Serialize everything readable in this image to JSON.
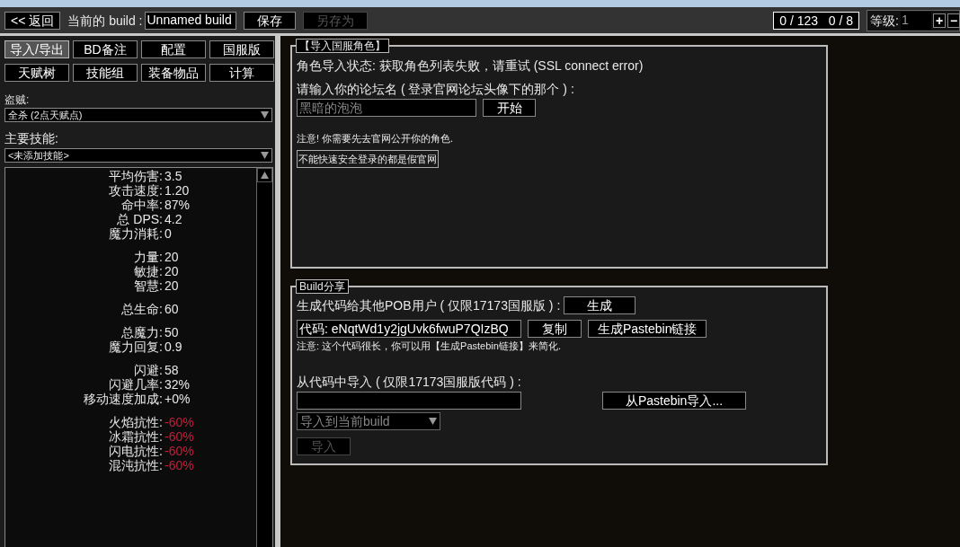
{
  "toolbar": {
    "back_button": "<< 返回",
    "build_label": "当前的 build :",
    "build_name": "Unnamed build",
    "save_button": {
      "label": "保存",
      "disabled": false
    },
    "save_as_button": {
      "label": "另存为",
      "disabled": true
    },
    "points": "0 / 123   0 / 8",
    "level_label": "等级:",
    "level_value": "1",
    "plus": "+",
    "minus": "−"
  },
  "tabs": [
    {
      "label": "导入/导出",
      "selected": true
    },
    {
      "label": "BD备注",
      "selected": false
    },
    {
      "label": "配置",
      "selected": false
    },
    {
      "label": "国服版",
      "selected": false
    },
    {
      "label": "天赋树",
      "selected": false
    },
    {
      "label": "技能组",
      "selected": false
    },
    {
      "label": "装备物品",
      "selected": false
    },
    {
      "label": "计算",
      "selected": false
    }
  ],
  "class_label": "盗贼:",
  "class_select": "全杀 (2点天赋点)",
  "skill_label": "主要技能:",
  "skill_select": "<未添加技能>",
  "stat_groups": [
    [
      {
        "label": "平均伤害:",
        "value": "3.5",
        "negative": false
      },
      {
        "label": "攻击速度:",
        "value": "1.20",
        "negative": false
      },
      {
        "label": "命中率:",
        "value": "87%",
        "negative": false
      },
      {
        "label": "总 DPS:",
        "value": "4.2",
        "negative": false
      },
      {
        "label": "魔力消耗:",
        "value": "0",
        "negative": false
      }
    ],
    [
      {
        "label": "力量:",
        "value": "20",
        "negative": false
      },
      {
        "label": "敏捷:",
        "value": "20",
        "negative": false
      },
      {
        "label": "智慧:",
        "value": "20",
        "negative": false
      }
    ],
    [
      {
        "label": "总生命:",
        "value": "60",
        "negative": false
      }
    ],
    [
      {
        "label": "总魔力:",
        "value": "50",
        "negative": false
      },
      {
        "label": "魔力回复:",
        "value": "0.9",
        "negative": false
      }
    ],
    [
      {
        "label": "闪避:",
        "value": "58",
        "negative": false
      },
      {
        "label": "闪避几率:",
        "value": "32%",
        "negative": false
      },
      {
        "label": "移动速度加成:",
        "value": "+0%",
        "negative": false
      }
    ],
    [
      {
        "label": "火焰抗性:",
        "value": "-60%",
        "negative": true
      },
      {
        "label": "冰霜抗性:",
        "value": "-60%",
        "negative": true
      },
      {
        "label": "闪电抗性:",
        "value": "-60%",
        "negative": true
      },
      {
        "label": "混沌抗性:",
        "value": "-60%",
        "negative": true
      }
    ]
  ],
  "import_section": {
    "title": "【导入国服角色】",
    "status": "角色导入状态: 获取角色列表失败，请重试 (SSL connect error)",
    "prompt": "请输入你的论坛名 ( 登录官网论坛头像下的那个 ) :",
    "account_placeholder": "黑暗的泡泡",
    "start_button": "开始",
    "note": "注意! 你需要先去官网公开你的角色.",
    "warning": "不能快速安全登录的都是假官网"
  },
  "share_section": {
    "title": "Build分享",
    "generate_label": "生成代码给其他POB用户 ( 仅限17173国服版 ) :",
    "generate_button": "生成",
    "code_value": "代码: eNqtWd1y2jgUvk6fwuP7QIzBQ",
    "copy_button": "复制",
    "pastebin_button": "生成Pastebin链接",
    "note": "注意: 这个代码很长，你可以用【生成Pastebin链接】来简化.",
    "import_label": "从代码中导入 ( 仅限17173国服版代码 ) :",
    "pastebin_import_button": "从Pastebin导入...",
    "import_mode": "导入到当前build",
    "import_button": {
      "label": "导入",
      "disabled": true
    }
  }
}
